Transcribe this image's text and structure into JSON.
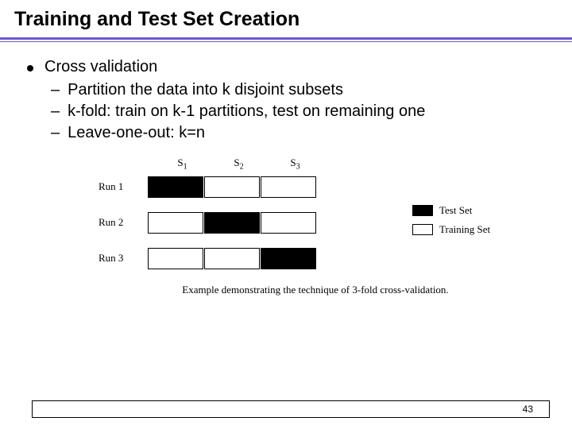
{
  "title": "Training and Test Set Creation",
  "bullet": {
    "main": "Cross validation",
    "subs": [
      "Partition the data into k disjoint subsets",
      "k-fold: train on k-1 partitions, test on remaining one",
      "Leave-one-out:   k=n"
    ]
  },
  "diagram": {
    "headers": [
      "S",
      "S",
      "S"
    ],
    "headerSubs": [
      "1",
      "2",
      "3"
    ],
    "runs": [
      {
        "label": "Run 1",
        "cells": [
          "filled",
          "empty",
          "empty"
        ]
      },
      {
        "label": "Run 2",
        "cells": [
          "empty",
          "filled",
          "empty"
        ]
      },
      {
        "label": "Run 3",
        "cells": [
          "empty",
          "empty",
          "filled"
        ]
      }
    ],
    "legend": [
      {
        "fill": "filled",
        "text": "Test Set"
      },
      {
        "fill": "empty",
        "text": "Training Set"
      }
    ],
    "caption": "Example demonstrating the technique of 3-fold cross-validation."
  },
  "pageNumber": "43"
}
